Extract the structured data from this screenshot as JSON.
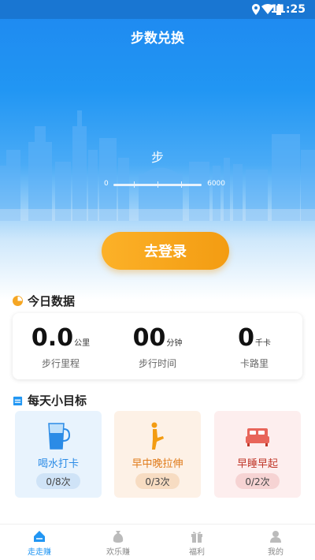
{
  "status_bar": {
    "time": "11:25"
  },
  "header": {
    "title": "步数兑换"
  },
  "hero": {
    "steps_label": "步",
    "range_min": "0",
    "range_max": "6000",
    "progress_fraction": 0
  },
  "login_button": {
    "label": "去登录"
  },
  "today": {
    "title": "今日数据",
    "stats": [
      {
        "value": "0.0",
        "unit": "公里",
        "label": "步行里程"
      },
      {
        "value": "00",
        "unit": "分钟",
        "label": "步行时间"
      },
      {
        "value": "0",
        "unit": "千卡",
        "label": "卡路里"
      }
    ]
  },
  "goals": {
    "title": "每天小目标",
    "items": [
      {
        "name": "喝水打卡",
        "progress": "0/8次",
        "color": "#2b8be6",
        "bg": "#e8f3fd",
        "badge_bg": "#cfe3f7",
        "icon": "water-glass-icon"
      },
      {
        "name": "早中晚拉伸",
        "progress": "0/3次",
        "color": "#e07b1a",
        "bg": "#fdf1e6",
        "badge_bg": "#f7dcc2",
        "icon": "stretch-icon"
      },
      {
        "name": "早睡早起",
        "progress": "0/2次",
        "color": "#c0392b",
        "bg": "#fdeeee",
        "badge_bg": "#f6d3d3",
        "icon": "bed-icon"
      }
    ]
  },
  "tabbar": {
    "items": [
      {
        "label": "走走赚",
        "active": true
      },
      {
        "label": "欢乐赚",
        "active": false
      },
      {
        "label": "福利",
        "active": false
      },
      {
        "label": "我的",
        "active": false
      }
    ]
  },
  "colors": {
    "accent": "#2196f3",
    "button": "#f5a623"
  }
}
